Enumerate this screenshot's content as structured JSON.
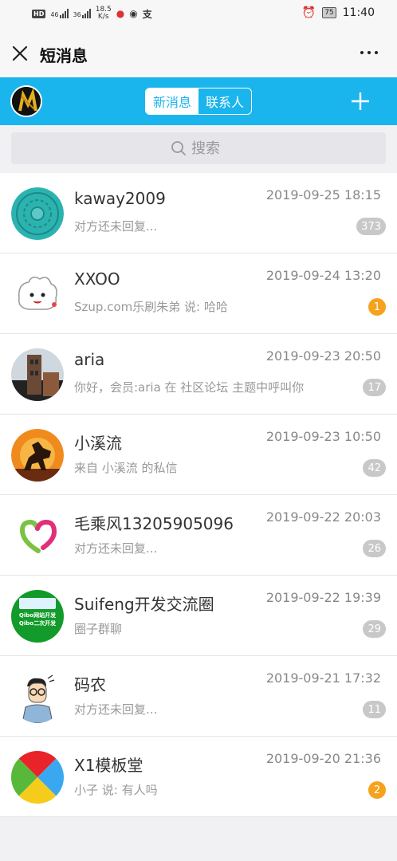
{
  "status_bar": {
    "net_badge": "HD",
    "sig1": "46",
    "sig2": "36",
    "speed_value": "18.5",
    "speed_unit": "K/s",
    "battery": "75",
    "time": "11:40"
  },
  "header": {
    "title": "短消息"
  },
  "toolbar": {
    "tabs": [
      {
        "label": "新消息",
        "active": true
      },
      {
        "label": "联系人",
        "active": false
      }
    ]
  },
  "search": {
    "placeholder": "搜索"
  },
  "conversations": [
    {
      "name": "kaway2009",
      "time": "2019-09-25 18:15",
      "preview": "对方还未回复...",
      "badge": "373",
      "badge_color": "gray"
    },
    {
      "name": "XXOO",
      "time": "2019-09-24 13:20",
      "preview": "Szup.com乐刷朱弟 说: 哈哈",
      "badge": "1",
      "badge_color": "orange"
    },
    {
      "name": "aria",
      "time": "2019-09-23 20:50",
      "preview": "你好，会员:aria 在 社区论坛 主题中呼叫你",
      "badge": "17",
      "badge_color": "gray"
    },
    {
      "name": "小溪流",
      "time": "2019-09-23 10:50",
      "preview": "来自 小溪流 的私信",
      "badge": "42",
      "badge_color": "gray"
    },
    {
      "name": "毛乘风13205905096",
      "time": "2019-09-22 20:03",
      "preview": "对方还未回复...",
      "badge": "26",
      "badge_color": "gray"
    },
    {
      "name": "Suifeng开发交流圈",
      "time": "2019-09-22 19:39",
      "preview": "圈子群聊",
      "badge": "29",
      "badge_color": "gray",
      "avatar_text": [
        "Qibo网站开发",
        "Qibo二次开发"
      ]
    },
    {
      "name": "码农",
      "time": "2019-09-21 17:32",
      "preview": "对方还未回复...",
      "badge": "11",
      "badge_color": "gray"
    },
    {
      "name": "X1模板堂",
      "time": "2019-09-20 21:36",
      "preview": "小子 说: 有人吗",
      "badge": "2",
      "badge_color": "orange"
    }
  ],
  "colors": {
    "primary": "#1bb5ed",
    "badge_gray": "#c8c8c8",
    "badge_orange": "#f5a21d"
  }
}
